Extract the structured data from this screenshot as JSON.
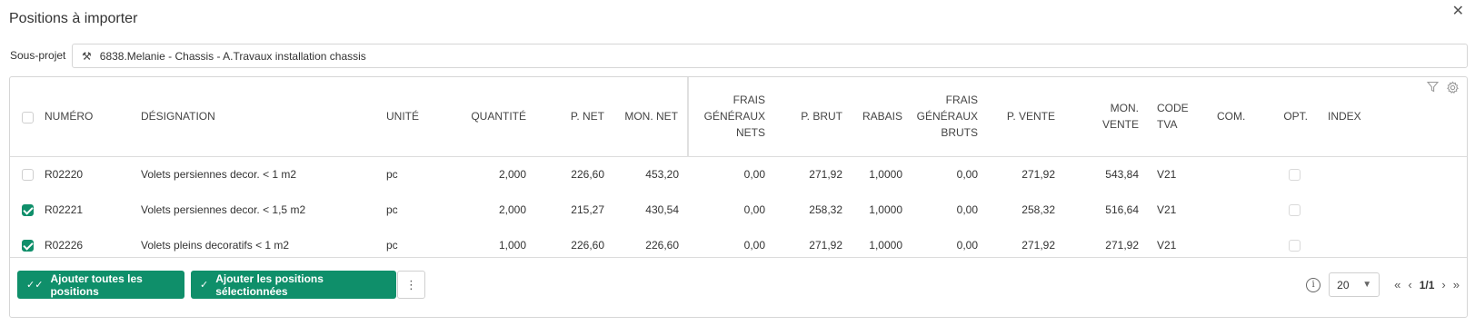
{
  "dialog": {
    "title": "Positions à importer",
    "close_icon": "close-icon"
  },
  "subproject": {
    "label": "Sous-projet",
    "icon": "tools-icon",
    "value": "6838.Melanie - Chassis - A.Travaux installation chassis"
  },
  "table": {
    "toolbar_icons": [
      "filter-icon",
      "gear-icon"
    ],
    "headers": {
      "numero": "NUMÉRO",
      "designation": "DÉSIGNATION",
      "unite": "UNITÉ",
      "quantite": "QUANTITÉ",
      "p_net": "P. NET",
      "mon_net": "MON. NET",
      "frais_nets": [
        "FRAIS",
        "GÉNÉRAUX",
        "NETS"
      ],
      "p_brut": "P. BRUT",
      "rabais": "RABAIS",
      "frais_bruts": [
        "FRAIS",
        "GÉNÉRAUX",
        "BRUTS"
      ],
      "p_vente": "P. VENTE",
      "mon_vente": [
        "MON.",
        "VENTE"
      ],
      "code_tva": [
        "CODE",
        "TVA"
      ],
      "com": "COM.",
      "opt": "OPT.",
      "index": "INDEX"
    },
    "rows": [
      {
        "selected": false,
        "numero": "R02220",
        "designation": "Volets persiennes decor. < 1 m2",
        "unite": "pc",
        "quantite": "2,000",
        "p_net": "226,60",
        "mon_net": "453,20",
        "frais_nets": "0,00",
        "p_brut": "271,92",
        "rabais": "1,0000",
        "frais_bruts": "0,00",
        "p_vente": "271,92",
        "mon_vente": "543,84",
        "code_tva": "V21",
        "com": "",
        "opt": false,
        "index": ""
      },
      {
        "selected": true,
        "numero": "R02221",
        "designation": "Volets persiennes decor. < 1,5 m2",
        "unite": "pc",
        "quantite": "2,000",
        "p_net": "215,27",
        "mon_net": "430,54",
        "frais_nets": "0,00",
        "p_brut": "258,32",
        "rabais": "1,0000",
        "frais_bruts": "0,00",
        "p_vente": "258,32",
        "mon_vente": "516,64",
        "code_tva": "V21",
        "com": "",
        "opt": false,
        "index": ""
      },
      {
        "selected": true,
        "numero": "R02226",
        "designation": "Volets pleins decoratifs < 1 m2",
        "unite": "pc",
        "quantite": "1,000",
        "p_net": "226,60",
        "mon_net": "226,60",
        "frais_nets": "0,00",
        "p_brut": "271,92",
        "rabais": "1,0000",
        "frais_bruts": "0,00",
        "p_vente": "271,92",
        "mon_vente": "271,92",
        "code_tva": "V21",
        "com": "",
        "opt": false,
        "index": ""
      }
    ]
  },
  "footer": {
    "add_all": {
      "icon": "double-check-icon",
      "label": "Ajouter toutes les positions"
    },
    "add_selected": {
      "icon": "check-icon",
      "label": "Ajouter les positions sélectionnées"
    },
    "more_icon": "more-vertical-icon",
    "pager": {
      "info_icon": "info-icon",
      "page_size": "20",
      "page_info": "1/1"
    }
  },
  "colors": {
    "primary": "#0f8f6a",
    "border": "#d6d6d6"
  }
}
